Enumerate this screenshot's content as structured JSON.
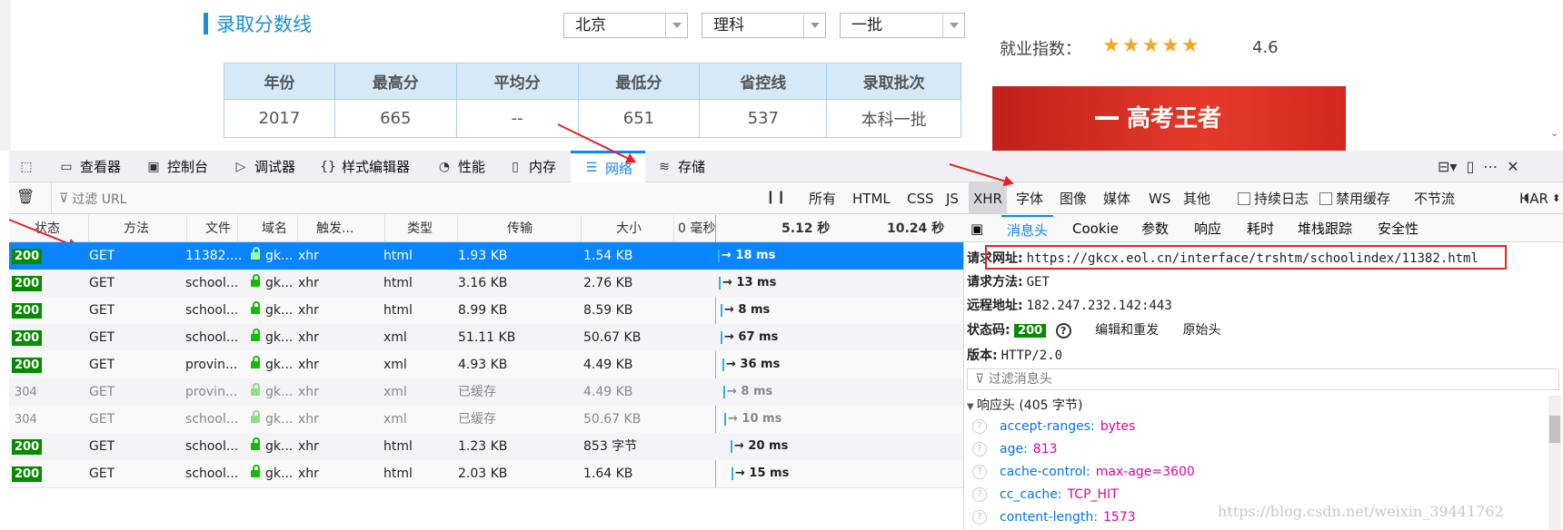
{
  "page": {
    "section_title": "录取分数线",
    "selects": [
      "北京",
      "理科",
      "一批"
    ],
    "table": {
      "headers": [
        "年份",
        "最高分",
        "平均分",
        "最低分",
        "省控线",
        "录取批次"
      ],
      "row": [
        "2017",
        "665",
        "--",
        "651",
        "537",
        "本科一批"
      ]
    },
    "employment_label": "就业指数：",
    "employment_stars": "★★★★★",
    "employment_rating": 5,
    "employment_score": "4.6",
    "banner_text": "高考王者"
  },
  "devtools": {
    "tabs": [
      {
        "label": "查看器",
        "icon": "inspector-icon"
      },
      {
        "label": "控制台",
        "icon": "console-icon"
      },
      {
        "label": "调试器",
        "icon": "debugger-icon"
      },
      {
        "label": "样式编辑器",
        "icon": "style-editor-icon"
      },
      {
        "label": "性能",
        "icon": "performance-icon"
      },
      {
        "label": "内存",
        "icon": "memory-icon"
      },
      {
        "label": "网络",
        "icon": "network-icon"
      },
      {
        "label": "存储",
        "icon": "storage-icon"
      }
    ],
    "active_tab": "网络",
    "filter_placeholder": "过滤 URL",
    "filter_types": [
      "所有",
      "HTML",
      "CSS",
      "JS",
      "XHR",
      "字体",
      "图像",
      "媒体",
      "WS",
      "其他"
    ],
    "active_filter": "XHR",
    "persist_log": "持续日志",
    "disable_cache": "禁用缓存",
    "throttle": "不节流",
    "har": "HAR",
    "columns": [
      "状态",
      "方法",
      "文件",
      "域名",
      "触发...",
      "类型",
      "传输",
      "大小",
      "0 毫秒",
      "5.12 秒",
      "10.24 秒"
    ],
    "requests": [
      {
        "status": "200",
        "method": "GET",
        "file": "11382....",
        "domain": "gk...",
        "cause": "xhr",
        "type": "html",
        "transferred": "1.93 KB",
        "size": "1.54 KB",
        "time": "→ 18 ms",
        "cached": false
      },
      {
        "status": "200",
        "method": "GET",
        "file": "school...",
        "domain": "gk...",
        "cause": "xhr",
        "type": "html",
        "transferred": "3.16 KB",
        "size": "2.76 KB",
        "time": "→ 13 ms",
        "cached": false
      },
      {
        "status": "200",
        "method": "GET",
        "file": "school...",
        "domain": "gk...",
        "cause": "xhr",
        "type": "html",
        "transferred": "8.99 KB",
        "size": "8.59 KB",
        "time": "→ 8 ms",
        "cached": false
      },
      {
        "status": "200",
        "method": "GET",
        "file": "school...",
        "domain": "gk...",
        "cause": "xhr",
        "type": "xml",
        "transferred": "51.11 KB",
        "size": "50.67 KB",
        "time": "→ 67 ms",
        "cached": false
      },
      {
        "status": "200",
        "method": "GET",
        "file": "provin...",
        "domain": "gk...",
        "cause": "xhr",
        "type": "xml",
        "transferred": "4.93 KB",
        "size": "4.49 KB",
        "time": "→ 36 ms",
        "cached": false
      },
      {
        "status": "304",
        "method": "GET",
        "file": "provin...",
        "domain": "gk...",
        "cause": "xhr",
        "type": "xml",
        "transferred": "已缓存",
        "size": "4.49 KB",
        "time": "→ 8 ms",
        "cached": true
      },
      {
        "status": "304",
        "method": "GET",
        "file": "school...",
        "domain": "gk...",
        "cause": "xhr",
        "type": "xml",
        "transferred": "已缓存",
        "size": "50.67 KB",
        "time": "→ 10 ms",
        "cached": true
      },
      {
        "status": "200",
        "method": "GET",
        "file": "school...",
        "domain": "gk...",
        "cause": "xhr",
        "type": "html",
        "transferred": "1.23 KB",
        "size": "853 字节",
        "time": "→ 20 ms",
        "cached": false
      },
      {
        "status": "200",
        "method": "GET",
        "file": "school...",
        "domain": "gk...",
        "cause": "xhr",
        "type": "html",
        "transferred": "2.03 KB",
        "size": "1.64 KB",
        "time": "→ 15 ms",
        "cached": false
      }
    ],
    "details": {
      "tabs": [
        "消息头",
        "Cookie",
        "参数",
        "响应",
        "耗时",
        "堆栈跟踪",
        "安全性"
      ],
      "active_tab": "消息头",
      "request_url_label": "请求网址:",
      "request_url": "https://gkcx.eol.cn/interface/trshtm/schoolindex/11382.html",
      "method_label": "请求方法:",
      "method": "GET",
      "remote_label": "远程地址:",
      "remote": "182.247.232.142:443",
      "status_label": "状态码:",
      "status": "200",
      "edit_resend": "编辑和重发",
      "raw_headers": "原始头",
      "version_label": "版本:",
      "version": "HTTP/2.0",
      "filter_headers": "过滤消息头",
      "response_headers": "响应头 (405 字节)",
      "headers": [
        {
          "key": "accept-ranges:",
          "value": "bytes"
        },
        {
          "key": "age:",
          "value": "813"
        },
        {
          "key": "cache-control:",
          "value": "max-age=3600"
        },
        {
          "key": "cc_cache:",
          "value": "TCP_HIT"
        },
        {
          "key": "content-length:",
          "value": "1573"
        }
      ]
    }
  },
  "watermark": "https://blog.csdn.net/weixin_39441762",
  "colors": {
    "accent": "#0a84ff",
    "status_ok": "#058b00",
    "annotation": "#e5222a",
    "page_blue": "#1a8fd8"
  }
}
